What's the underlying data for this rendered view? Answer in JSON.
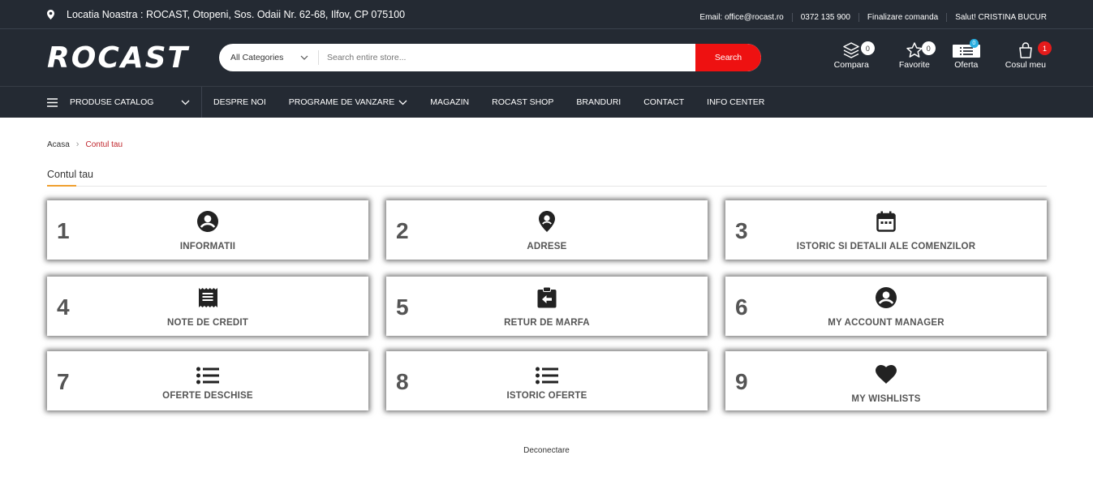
{
  "topbar": {
    "location": "Locatia Noastra : ROCAST, Otopeni, Sos. Odaii Nr. 62-68, Ilfov, CP 075100",
    "links": [
      "Email: office@rocast.ro",
      "0372 135 900",
      "Finalizare comanda",
      "Salut! CRISTINA BUCUR"
    ]
  },
  "header": {
    "logo": "ROCAST",
    "search": {
      "category": "All Categories",
      "placeholder": "Search entire store...",
      "button": "Search"
    },
    "icons": [
      {
        "label": "Compara",
        "icon": "compare-layers-icon",
        "badge": "0"
      },
      {
        "label": "Favorite",
        "icon": "star-icon",
        "badge": "0"
      },
      {
        "label": "Oferta",
        "icon": "offer-list-icon",
        "badge": "0"
      },
      {
        "label": "Cosul meu",
        "icon": "shopping-bag-icon",
        "badge": "1"
      }
    ]
  },
  "nav": {
    "catalog": "PRODUSE CATALOG",
    "items": [
      "DESPRE NOI",
      "PROGRAME DE VANZARE",
      "MAGAZIN",
      "ROCAST SHOP",
      "BRANDURI",
      "CONTACT",
      "INFO CENTER"
    ]
  },
  "breadcrumb": {
    "home": "Acasa",
    "current": "Contul tau"
  },
  "page_title": "Contul tau",
  "cards": [
    {
      "num": "1",
      "label": "INFORMATII",
      "icon": "account-circle-icon"
    },
    {
      "num": "2",
      "label": "ADRESE",
      "icon": "location-pin-icon"
    },
    {
      "num": "3",
      "label": "ISTORIC SI DETALII ALE COMENZILOR",
      "icon": "calendar-icon"
    },
    {
      "num": "4",
      "label": "NOTE DE CREDIT",
      "icon": "receipt-icon"
    },
    {
      "num": "5",
      "label": "RETUR DE MARFA",
      "icon": "return-clipboard-icon"
    },
    {
      "num": "6",
      "label": "MY ACCOUNT MANAGER",
      "icon": "account-circle-icon"
    },
    {
      "num": "7",
      "label": "OFERTE DESCHISE",
      "icon": "list-icon"
    },
    {
      "num": "8",
      "label": "ISTORIC OFERTE",
      "icon": "list-icon"
    },
    {
      "num": "9",
      "label": "MY WISHLISTS",
      "icon": "heart-icon"
    }
  ],
  "logout": "Deconectare",
  "colors": {
    "header_bg": "#242a33",
    "accent_red": "#ee1111",
    "breadcrumb_active": "#c0262d",
    "title_underline": "#f0a030"
  }
}
